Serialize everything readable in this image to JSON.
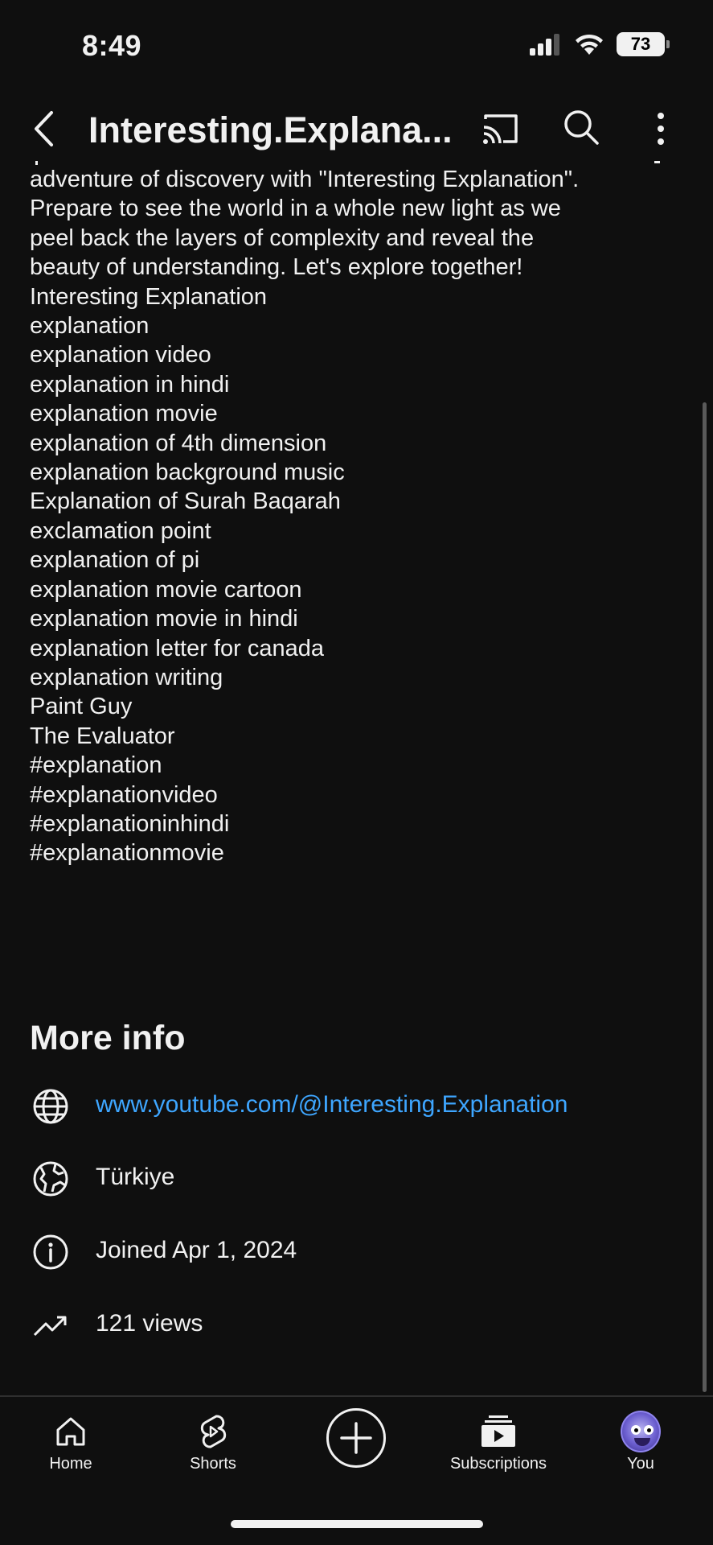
{
  "status_bar": {
    "time": "8:49",
    "battery": "73"
  },
  "header": {
    "title": "Interesting.Explana..."
  },
  "description": {
    "lines": [
      "adventure of discovery with \"Interesting Explanation\".",
      "Prepare to see the world in a whole new light as we",
      "peel back the layers of complexity and reveal the",
      "beauty of understanding. Let's explore together!",
      "Interesting Explanation",
      "explanation",
      "explanation video",
      "explanation in hindi",
      "explanation movie",
      "explanation of 4th dimension",
      "explanation background music",
      "Explanation of Surah Baqarah",
      "exclamation point",
      "explanation of pi",
      "explanation movie cartoon",
      "explanation movie in hindi",
      "explanation letter for canada",
      "explanation writing",
      "Paint Guy",
      "The Evaluator",
      "#explanation",
      "#explanationvideo",
      "#explanationinhindi",
      "#explanationmovie"
    ]
  },
  "more_info": {
    "title": "More info",
    "url": "www.youtube.com/@Interesting.Explanation",
    "country": "Türkiye",
    "joined": "Joined Apr 1, 2024",
    "views": "121 views"
  },
  "nav": {
    "home": "Home",
    "shorts": "Shorts",
    "subscriptions": "Subscriptions",
    "you": "You"
  },
  "colors": {
    "background": "#0f0f0f",
    "text": "#f1f1f1",
    "link": "#3ea6ff"
  }
}
